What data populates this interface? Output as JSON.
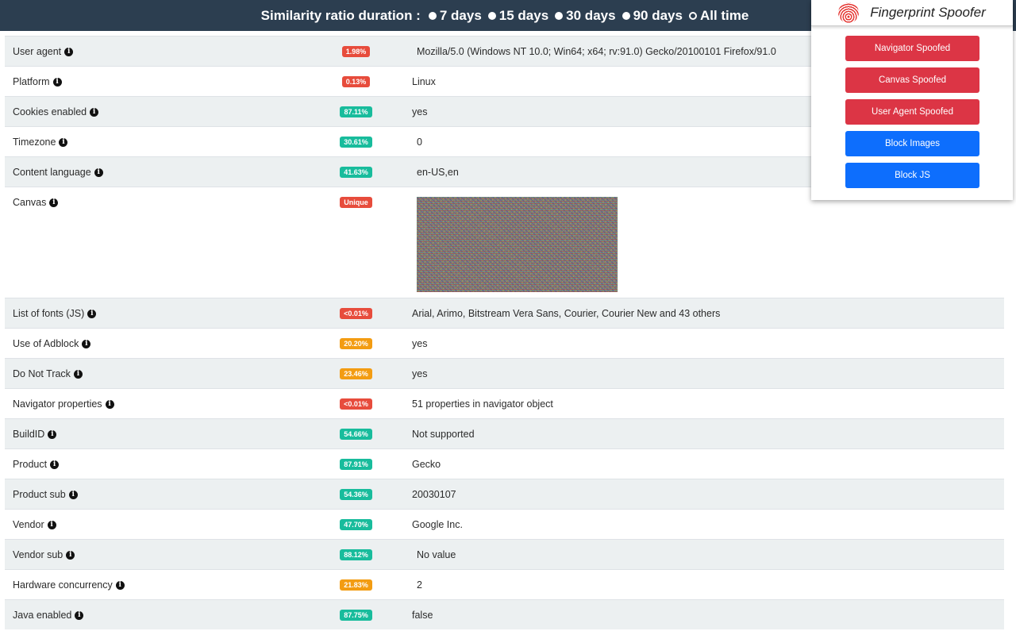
{
  "topbar": {
    "title": "Similarity ratio duration :",
    "options": [
      "7 days",
      "15 days",
      "30 days",
      "90 days",
      "All time"
    ],
    "selected": "All time"
  },
  "rows": [
    {
      "label": "User agent",
      "ratio": "1.98%",
      "color": "red",
      "value": "Mozilla/5.0 (Windows NT 10.0; Win64; x64; rv:91.0) Gecko/20100101 Firefox/91.0"
    },
    {
      "label": "Platform",
      "ratio": "0.13%",
      "color": "red",
      "value": "Linux"
    },
    {
      "label": "Cookies enabled",
      "ratio": "87.11%",
      "color": "green",
      "value": "yes"
    },
    {
      "label": "Timezone",
      "ratio": "30.61%",
      "color": "green",
      "value": "0"
    },
    {
      "label": "Content language",
      "ratio": "41.63%",
      "color": "green",
      "value": "en-US,en"
    },
    {
      "label": "Canvas",
      "ratio": "Unique",
      "color": "red",
      "value": ""
    },
    {
      "label": "List of fonts (JS)",
      "ratio": "<0.01%",
      "color": "red",
      "value": "Arial, Arimo, Bitstream Vera Sans, Courier, Courier New and 43 others"
    },
    {
      "label": "Use of Adblock",
      "ratio": "20.20%",
      "color": "orange",
      "value": "yes"
    },
    {
      "label": "Do Not Track",
      "ratio": "23.46%",
      "color": "orange",
      "value": "yes"
    },
    {
      "label": "Navigator properties",
      "ratio": "<0.01%",
      "color": "red",
      "value": "51 properties in navigator object"
    },
    {
      "label": "BuildID",
      "ratio": "54.66%",
      "color": "green",
      "value": "Not supported"
    },
    {
      "label": "Product",
      "ratio": "87.91%",
      "color": "green",
      "value": "Gecko"
    },
    {
      "label": "Product sub",
      "ratio": "54.36%",
      "color": "green",
      "value": "20030107"
    },
    {
      "label": "Vendor",
      "ratio": "47.70%",
      "color": "green",
      "value": "Google Inc."
    },
    {
      "label": "Vendor sub",
      "ratio": "88.12%",
      "color": "green",
      "value": "No value"
    },
    {
      "label": "Hardware concurrency",
      "ratio": "21.83%",
      "color": "orange",
      "value": "2"
    },
    {
      "label": "Java enabled",
      "ratio": "87.75%",
      "color": "green",
      "value": "false"
    }
  ],
  "popup": {
    "title": "Fingerprint Spoofer",
    "buttons": [
      {
        "label": "Navigator Spoofed",
        "style": "danger"
      },
      {
        "label": "Canvas Spoofed",
        "style": "danger"
      },
      {
        "label": "User Agent Spoofed",
        "style": "danger"
      },
      {
        "label": "Block Images",
        "style": "primary"
      },
      {
        "label": "Block JS",
        "style": "primary"
      }
    ]
  },
  "colors": {
    "topbar": "#2c3e50",
    "red": "#e74c3c",
    "green": "#18bc9c",
    "orange": "#f39c12",
    "danger_button": "#dc3545",
    "primary_button": "#0d6efd"
  }
}
